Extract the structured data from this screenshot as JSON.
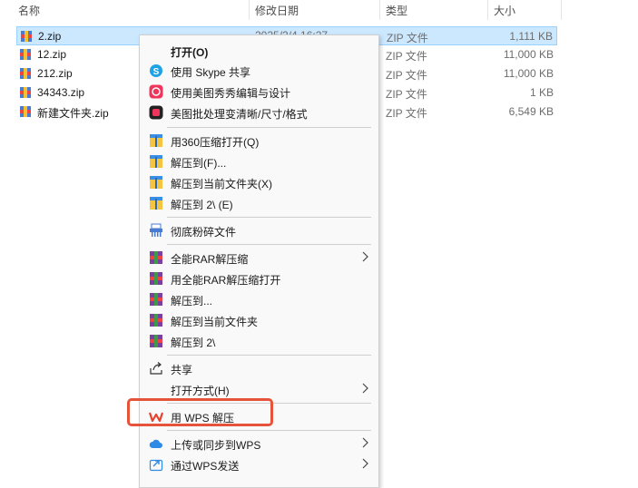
{
  "columns": {
    "name": "名称",
    "date": "修改日期",
    "type": "类型",
    "size": "大小"
  },
  "files": [
    {
      "name": "2.zip",
      "date": "2025/2/4 16:27",
      "type": "ZIP 文件",
      "size": "1,111 KB"
    },
    {
      "name": "12.zip",
      "date": "",
      "type": "ZIP 文件",
      "size": "11,000 KB"
    },
    {
      "name": "212.zip",
      "date": "",
      "type": "ZIP 文件",
      "size": "11,000 KB"
    },
    {
      "name": "34343.zip",
      "date": "",
      "type": "ZIP 文件",
      "size": "1 KB"
    },
    {
      "name": "新建文件夹.zip",
      "date": "",
      "type": "ZIP 文件",
      "size": "6,549 KB"
    }
  ],
  "menu": {
    "open": "打开(O)",
    "skype_share": "使用 Skype 共享",
    "meitu_edit": "使用美图秀秀编辑与设计",
    "meitu_batch": "美图批处理变清晰/尺寸/格式",
    "open_360": "用360压缩打开(Q)",
    "extract_to": "解压到(F)...",
    "extract_here_folder": "解压到当前文件夹(X)",
    "extract_to_2": "解压到 2\\ (E)",
    "shred": "彻底粉碎文件",
    "rar_extract": "全能RAR解压缩",
    "rar_open": "用全能RAR解压缩打开",
    "rar_extract_to": "解压到...",
    "rar_extract_here": "解压到当前文件夹",
    "rar_extract_2": "解压到 2\\",
    "share": "共享",
    "open_with": "打开方式(H)",
    "wps_extract": "用 WPS 解压",
    "upload_wps": "上传或同步到WPS",
    "send_wps": "通过WPS发送"
  },
  "colors": {
    "selection": "#cce8ff",
    "highlight": "#e5533b",
    "wps_red": "#e8412c"
  }
}
